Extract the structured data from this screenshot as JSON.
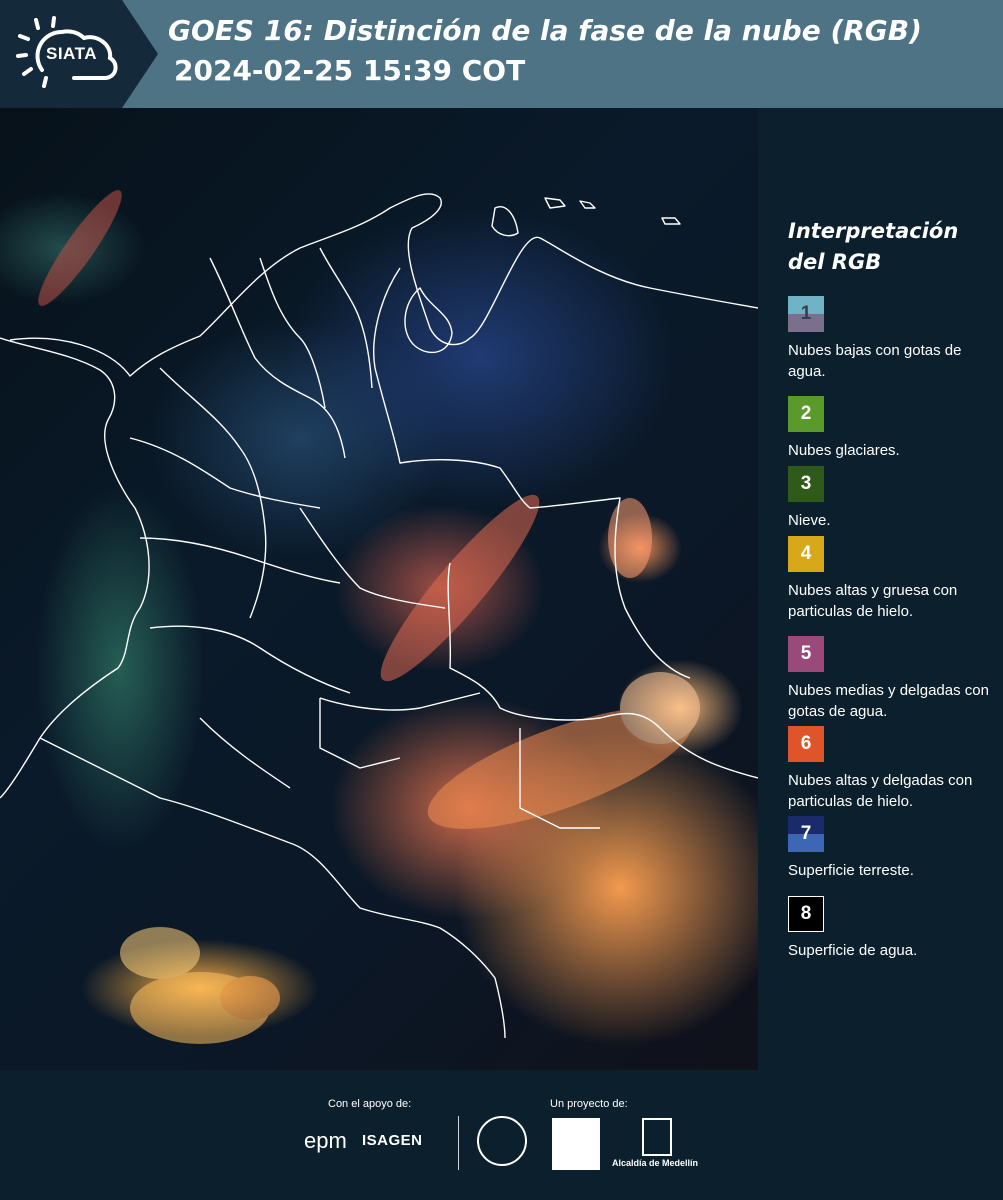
{
  "header": {
    "logo_text": "SIATA",
    "title_line1": "GOES 16: Distinción de la fase de la nube (RGB)",
    "title_line2": "2024-02-25 15:39 COT",
    "logo_icon": "sun-cloud-icon"
  },
  "legend": {
    "title": "Interpretación del RGB",
    "items": [
      {
        "num": "1",
        "colors": [
          "#6fb3c4",
          "#7a6f8c"
        ],
        "desc": "Nubes bajas con gotas de agua."
      },
      {
        "num": "2",
        "colors": [
          "#5a9a2a"
        ],
        "desc": "Nubes glaciares."
      },
      {
        "num": "3",
        "colors": [
          "#2f5a1a"
        ],
        "desc": "Nieve."
      },
      {
        "num": "4",
        "colors": [
          "#d6a81a"
        ],
        "desc": "Nubes altas y gruesa con particulas de hielo."
      },
      {
        "num": "5",
        "colors": [
          "#9a4a7a"
        ],
        "desc": "Nubes medias y delgadas con gotas de agua."
      },
      {
        "num": "6",
        "colors": [
          "#e0542a"
        ],
        "desc": "Nubes altas y delgadas con particulas de hielo."
      },
      {
        "num": "7",
        "colors": [
          "#1a2a6a",
          "#3d66b4"
        ],
        "desc": "Superficie terreste."
      },
      {
        "num": "8",
        "colors": [
          "#000000"
        ],
        "desc": "Superficie de agua."
      }
    ]
  },
  "footer": {
    "support_label": "Con el apoyo de:",
    "project_label": "Un proyecto de:",
    "epm": "epm",
    "isagen": "ISAGEN",
    "alcaldia": "Alcaldía de Medellín"
  }
}
